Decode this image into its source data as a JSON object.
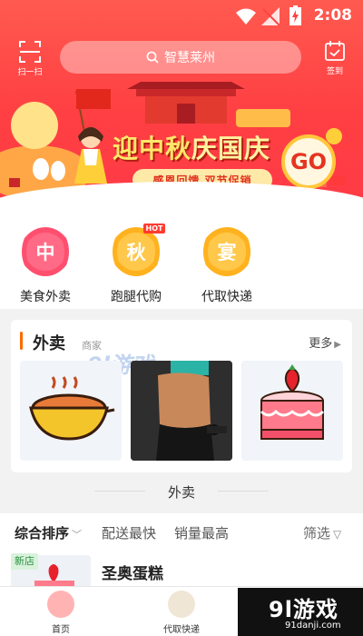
{
  "status_bar": {
    "time": "2:08"
  },
  "header": {
    "scan_label": "扫一扫",
    "checkin_label": "签到",
    "search_placeholder": "智慧莱州"
  },
  "banner": {
    "title_part1": "迎中秋",
    "title_part2": "庆国庆",
    "subtitle": "感恩回馈 双节促销",
    "go_label": "GO"
  },
  "categories": [
    {
      "glyph": "中",
      "label": "美食外卖",
      "icon": "food-icon",
      "color": "#ff4f6e"
    },
    {
      "glyph": "秋",
      "label": "跑腿代购",
      "icon": "errand-icon",
      "color": "#ffb21e",
      "badge": "HOT"
    },
    {
      "glyph": "宴",
      "label": "代取快递",
      "icon": "express-icon",
      "color": "#ffb21e"
    }
  ],
  "takeaway_card": {
    "title": "外卖",
    "subtitle": "商家",
    "more_label": "更多",
    "watermark": "9l游戏",
    "tiles": [
      "food-bowl-image",
      "fitness-image",
      "cake-image"
    ]
  },
  "section": {
    "title": "外卖"
  },
  "filters": {
    "sort_label": "综合排序",
    "fast_delivery_label": "配送最快",
    "best_sales_label": "销量最高",
    "filter_label": "筛选"
  },
  "list": [
    {
      "badge": "新店",
      "name": "圣奥蛋糕"
    }
  ],
  "bottom_nav": {
    "home_label": "首页",
    "express_label": "代取快递",
    "brand_big": "9l游戏",
    "brand_small": "91danji.com"
  },
  "colors": {
    "primary_red": "#ff4343",
    "accent_orange": "#ff6a00",
    "gold": "#ffc73a"
  }
}
